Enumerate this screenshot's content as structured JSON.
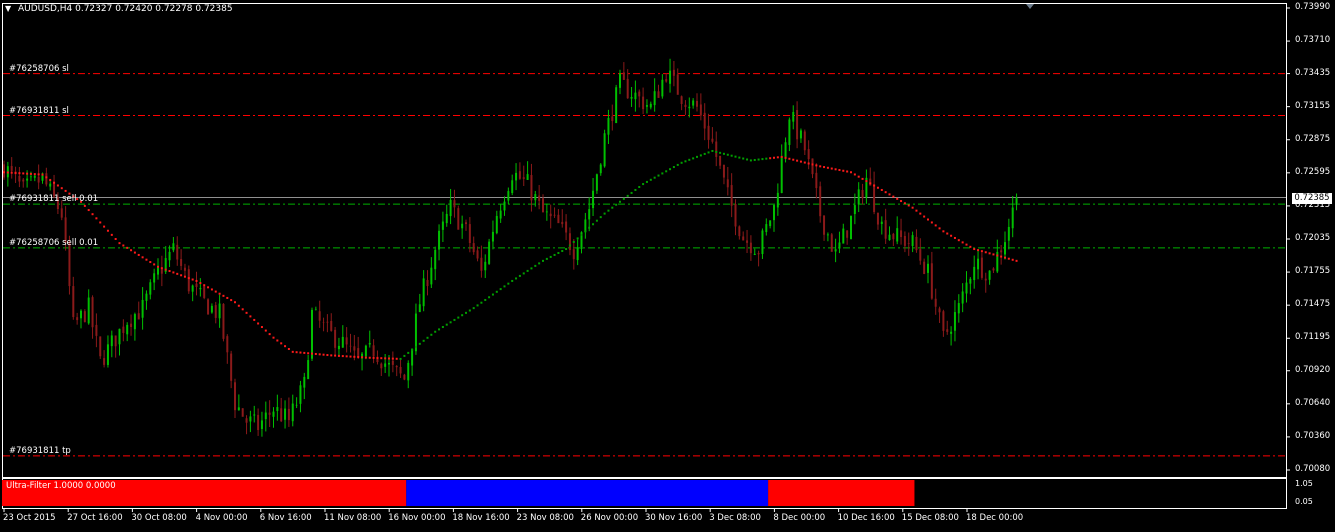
{
  "header": {
    "title": "AUDUSD,H4  0.72327 0.72420 0.72278 0.72385",
    "menu_icon": "triangle-down-icon"
  },
  "price_axis": {
    "ticks": [
      "0.73990",
      "0.73710",
      "0.73435",
      "0.73155",
      "0.72875",
      "0.72595",
      "0.72315",
      "0.72035",
      "0.71755",
      "0.71475",
      "0.71195",
      "0.70920",
      "0.70640",
      "0.70360",
      "0.70080"
    ],
    "current_price": "0.72385"
  },
  "time_axis": {
    "ticks": [
      "23 Oct 2015",
      "27 Oct 16:00",
      "30 Oct 08:00",
      "4 Nov 00:00",
      "6 Nov 16:00",
      "11 Nov 08:00",
      "16 Nov 00:00",
      "18 Nov 16:00",
      "23 Nov 08:00",
      "26 Nov 00:00",
      "30 Nov 16:00",
      "3 Dec 08:00",
      "8 Dec 00:00",
      "10 Dec 16:00",
      "15 Dec 08:00",
      "18 Dec 00:00"
    ]
  },
  "order_levels": [
    {
      "label": "#76258706 sl",
      "price": 0.73435,
      "kind": "stop"
    },
    {
      "label": "#76931811 sl",
      "price": 0.7308,
      "kind": "stop"
    },
    {
      "label": "#76931811 sell 0.01",
      "price": 0.7233,
      "kind": "entry"
    },
    {
      "label": "#76258706 sell 0.01",
      "price": 0.7196,
      "kind": "entry"
    },
    {
      "label": "#76931811 tp",
      "price": 0.702,
      "kind": "target"
    }
  ],
  "indicator": {
    "label": "Ultra-Filter 1.0000 0.0000",
    "ticks": [
      "1.05",
      "0.05"
    ],
    "segments": [
      {
        "color": "#ff0000",
        "bars": 105
      },
      {
        "color": "#0000ff",
        "bars": 94
      },
      {
        "color": "#ff0000",
        "bars": 38
      }
    ]
  },
  "colors": {
    "background": "#000000",
    "axis": "#ffffff",
    "bull_candle": "#00c000",
    "bear_candle": "#8b1a1a",
    "ma_up": "#00a000",
    "ma_down": "#ff1a1a",
    "stop_line": "#ff0000",
    "entry_line": "#00b000",
    "price_line": "#c0c0c0"
  },
  "chart_data": {
    "type": "candlestick",
    "symbol": "AUDUSD",
    "timeframe": "H4",
    "ylim": [
      0.7008,
      0.7399
    ],
    "last": {
      "open": 0.72327,
      "high": 0.7242,
      "low": 0.72278,
      "close": 0.72385
    },
    "close_path": [
      [
        0,
        0.7265
      ],
      [
        5,
        0.7245
      ],
      [
        10,
        0.7255
      ],
      [
        15,
        0.7225
      ],
      [
        18,
        0.713
      ],
      [
        22,
        0.7145
      ],
      [
        25,
        0.71
      ],
      [
        28,
        0.7115
      ],
      [
        32,
        0.7135
      ],
      [
        36,
        0.7145
      ],
      [
        40,
        0.7175
      ],
      [
        44,
        0.7195
      ],
      [
        48,
        0.7165
      ],
      [
        52,
        0.715
      ],
      [
        56,
        0.714
      ],
      [
        60,
        0.7065
      ],
      [
        63,
        0.705
      ],
      [
        66,
        0.7045
      ],
      [
        70,
        0.706
      ],
      [
        74,
        0.705
      ],
      [
        78,
        0.708
      ],
      [
        80,
        0.714
      ],
      [
        84,
        0.7125
      ],
      [
        88,
        0.7115
      ],
      [
        92,
        0.71
      ],
      [
        96,
        0.711
      ],
      [
        100,
        0.7095
      ],
      [
        104,
        0.7085
      ],
      [
        108,
        0.715
      ],
      [
        112,
        0.7195
      ],
      [
        116,
        0.723
      ],
      [
        120,
        0.721
      ],
      [
        124,
        0.7175
      ],
      [
        128,
        0.7225
      ],
      [
        132,
        0.726
      ],
      [
        136,
        0.725
      ],
      [
        140,
        0.7225
      ],
      [
        144,
        0.7215
      ],
      [
        148,
        0.7195
      ],
      [
        152,
        0.723
      ],
      [
        156,
        0.729
      ],
      [
        160,
        0.7335
      ],
      [
        164,
        0.7325
      ],
      [
        168,
        0.7315
      ],
      [
        172,
        0.7345
      ],
      [
        176,
        0.7325
      ],
      [
        180,
        0.7315
      ],
      [
        184,
        0.7285
      ],
      [
        188,
        0.724
      ],
      [
        192,
        0.7205
      ],
      [
        196,
        0.7195
      ],
      [
        200,
        0.723
      ],
      [
        204,
        0.731
      ],
      [
        208,
        0.728
      ],
      [
        212,
        0.7225
      ],
      [
        216,
        0.719
      ],
      [
        220,
        0.722
      ],
      [
        224,
        0.7255
      ],
      [
        228,
        0.7215
      ],
      [
        232,
        0.7205
      ],
      [
        236,
        0.72
      ],
      [
        240,
        0.7175
      ],
      [
        244,
        0.712
      ],
      [
        248,
        0.7145
      ],
      [
        252,
        0.7185
      ],
      [
        256,
        0.7175
      ],
      [
        260,
        0.7205
      ],
      [
        263,
        0.7238
      ]
    ],
    "moving_average": [
      [
        0,
        0.726
      ],
      [
        10,
        0.7258
      ],
      [
        20,
        0.7235
      ],
      [
        30,
        0.72
      ],
      [
        40,
        0.718
      ],
      [
        50,
        0.7168
      ],
      [
        60,
        0.715
      ],
      [
        70,
        0.712
      ],
      [
        75,
        0.7108
      ],
      [
        85,
        0.7105
      ],
      [
        95,
        0.7103
      ],
      [
        103,
        0.7102
      ],
      [
        112,
        0.7125
      ],
      [
        122,
        0.7145
      ],
      [
        132,
        0.7168
      ],
      [
        140,
        0.7185
      ],
      [
        146,
        0.7195
      ],
      [
        156,
        0.7225
      ],
      [
        166,
        0.725
      ],
      [
        176,
        0.7268
      ],
      [
        184,
        0.7278
      ],
      [
        194,
        0.727
      ],
      [
        202,
        0.7273
      ],
      [
        212,
        0.7265
      ],
      [
        220,
        0.726
      ],
      [
        228,
        0.7245
      ],
      [
        236,
        0.723
      ],
      [
        244,
        0.721
      ],
      [
        252,
        0.7195
      ],
      [
        263,
        0.7185
      ]
    ],
    "ma_turns": {
      "up_from_bar": 103,
      "down_from_bar": 199
    }
  }
}
